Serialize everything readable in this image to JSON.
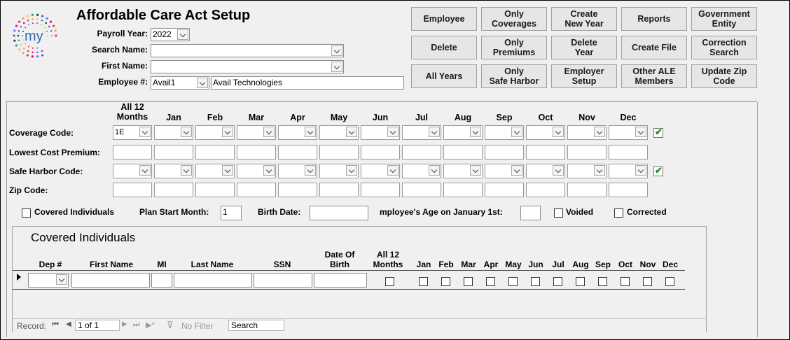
{
  "header": {
    "title": "Affordable Care Act Setup",
    "logo_text": "my"
  },
  "form": {
    "payroll_year_label": "Payroll Year:",
    "payroll_year_value": "2022",
    "search_name_label": "Search Name:",
    "search_name_value": "",
    "first_name_label": "First Name:",
    "first_name_value": "",
    "employee_no_label": "Employee #:",
    "employee_no_value": "Avail1",
    "employee_name_value": "Avail Technologies"
  },
  "buttons": [
    {
      "l1": "Employee",
      "l2": ""
    },
    {
      "l1": "Only",
      "l2": "Coverages"
    },
    {
      "l1": "Create",
      "l2": "New Year"
    },
    {
      "l1": "Reports",
      "l2": ""
    },
    {
      "l1": "Government",
      "l2": "Entity"
    },
    {
      "l1": "Delete",
      "l2": ""
    },
    {
      "l1": "Only",
      "l2": "Premiums"
    },
    {
      "l1": "Delete",
      "l2": "Year"
    },
    {
      "l1": "Create File",
      "l2": ""
    },
    {
      "l1": "Correction",
      "l2": "Search"
    },
    {
      "l1": "All Years",
      "l2": ""
    },
    {
      "l1": "Only",
      "l2": "Safe Harbor"
    },
    {
      "l1": "Employer",
      "l2": "Setup"
    },
    {
      "l1": "Other ALE",
      "l2": "Members"
    },
    {
      "l1": "Update Zip",
      "l2": "Code"
    }
  ],
  "coverage": {
    "months": [
      "All 12\nMonths",
      "Jan",
      "Feb",
      "Mar",
      "Apr",
      "May",
      "Jun",
      "Jul",
      "Aug",
      "Sep",
      "Oct",
      "Nov",
      "Dec"
    ],
    "rows": [
      {
        "label": "Coverage Code:",
        "type": "dropdown",
        "values": [
          "1E",
          "",
          "",
          "",
          "",
          "",
          "",
          "",
          "",
          "",
          "",
          "",
          ""
        ],
        "check": true
      },
      {
        "label": "Lowest Cost Premium:",
        "type": "text",
        "values": [
          "",
          "",
          "",
          "",
          "",
          "",
          "",
          "",
          "",
          "",
          "",
          "",
          ""
        ],
        "check": false
      },
      {
        "label": "Safe Harbor Code:",
        "type": "dropdown",
        "values": [
          "",
          "",
          "",
          "",
          "",
          "",
          "",
          "",
          "",
          "",
          "",
          "",
          ""
        ],
        "check": true
      },
      {
        "label": "Zip Code:",
        "type": "text",
        "values": [
          "",
          "",
          "",
          "",
          "",
          "",
          "",
          "",
          "",
          "",
          "",
          "",
          ""
        ],
        "check": false
      }
    ]
  },
  "options": {
    "covered_individuals_label": "Covered Individuals",
    "plan_start_month_label": "Plan Start Month:",
    "plan_start_month_value": "1",
    "birth_date_label": "Birth Date:",
    "birth_date_value": "",
    "age_label": "mployee's Age on January 1st:",
    "age_value": "",
    "voided_label": "Voided",
    "corrected_label": "Corrected"
  },
  "covered": {
    "title": "Covered Individuals",
    "columns": {
      "dep": "Dep #",
      "first": "First Name",
      "mi": "MI",
      "last": "Last Name",
      "ssn": "SSN",
      "dob": "Date Of\nBirth",
      "all12": "All 12\nMonths",
      "months": [
        "Jan",
        "Feb",
        "Mar",
        "Apr",
        "May",
        "Jun",
        "Jul",
        "Aug",
        "Sep",
        "Oct",
        "Nov",
        "Dec"
      ]
    }
  },
  "navigator": {
    "record_label": "Record:",
    "record_value": "1 of 1",
    "filter_label": "No Filter",
    "search_placeholder": "Search"
  }
}
